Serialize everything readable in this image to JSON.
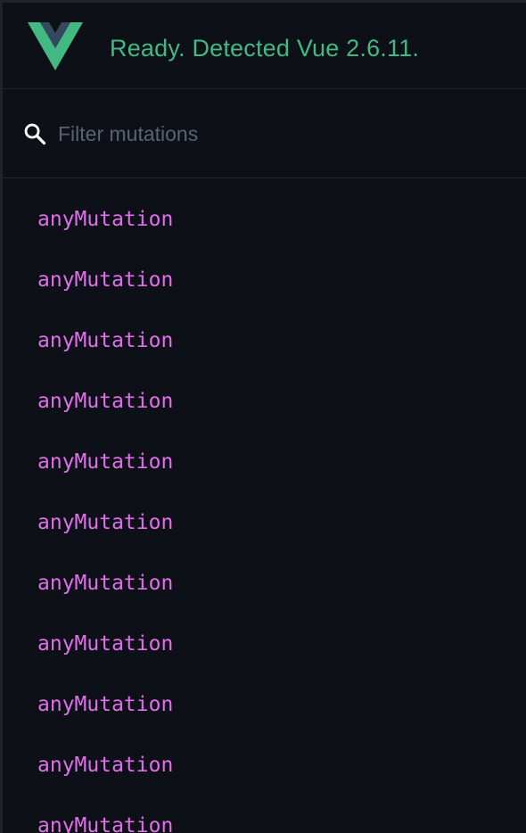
{
  "header": {
    "status": "Ready. Detected Vue 2.6.11.",
    "logo_icon": "vue-logo-icon",
    "brand_color": "#42b883"
  },
  "filter": {
    "placeholder": "Filter mutations",
    "value": "",
    "icon": "search-icon"
  },
  "mutations": [
    {
      "name": "anyMutation"
    },
    {
      "name": "anyMutation"
    },
    {
      "name": "anyMutation"
    },
    {
      "name": "anyMutation"
    },
    {
      "name": "anyMutation"
    },
    {
      "name": "anyMutation"
    },
    {
      "name": "anyMutation"
    },
    {
      "name": "anyMutation"
    },
    {
      "name": "anyMutation"
    },
    {
      "name": "anyMutation"
    },
    {
      "name": "anyMutation"
    }
  ],
  "colors": {
    "background": "#0d1117",
    "mutation_text": "#e36eec",
    "placeholder": "#5b636d"
  }
}
